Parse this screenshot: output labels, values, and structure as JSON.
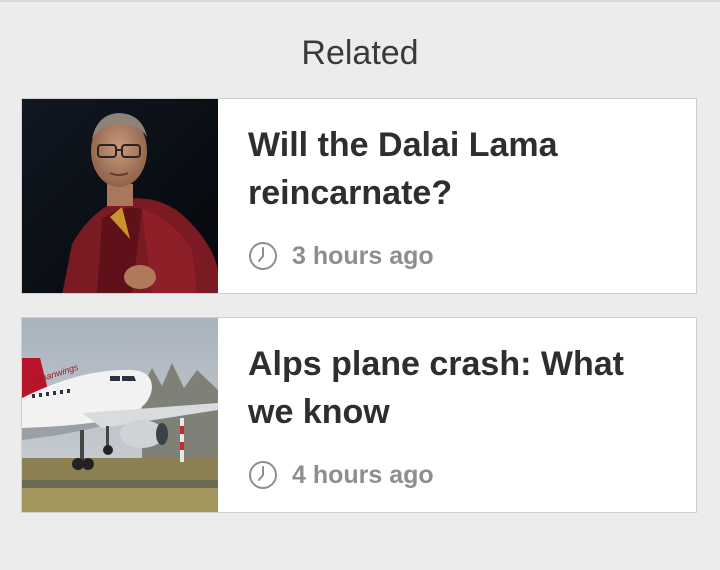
{
  "section": {
    "title": "Related"
  },
  "articles": [
    {
      "title": "Will the Dalai Lama reincarnate?",
      "time": "3 hours ago",
      "thumbnail": "dalai-lama-photo"
    },
    {
      "title": "Alps plane crash: What we know",
      "time": "4 hours ago",
      "thumbnail": "germanwings-plane-photo",
      "thumbnail_text": "germanwings"
    }
  ],
  "icons": {
    "time": "clock-icon"
  }
}
